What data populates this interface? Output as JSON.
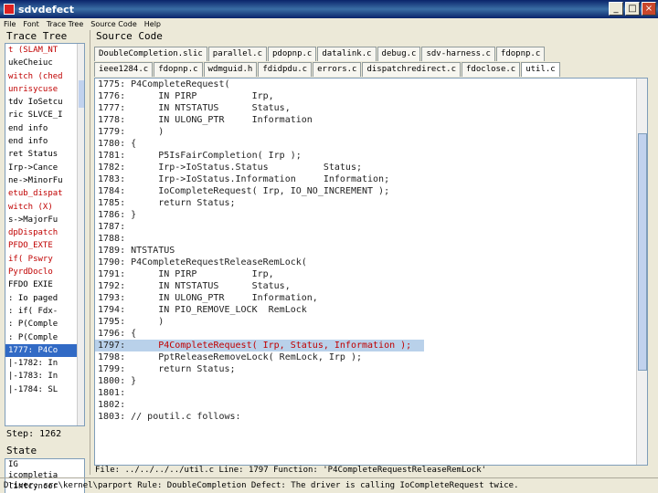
{
  "window": {
    "title": "sdvdefect",
    "minimize": "_",
    "maximize": "□",
    "close": "×"
  },
  "menu": [
    "File",
    "Font",
    "Trace Tree",
    "Source Code",
    "Help"
  ],
  "trace_tree": {
    "header": "Trace Tree",
    "lines": [
      "t (SLAM_NT",
      "ukeCheiuc",
      "witch (ched",
      "unrisycuse",
      "tdv IoSetcu",
      "ric SLVCE_I",
      "end info",
      "end info",
      "ret Status",
      "Irp->Cance",
      "ne->MinorFu",
      "etub_dispat",
      "witch (X)",
      "s->MajorFu",
      "dpDispatch",
      "  PFDO_EXTE",
      "  if( Pswry",
      "  PyrdDoclo",
      "  FFDO EXIE",
      ": Io paged",
      ": if( Fdx-",
      ": P(Comple",
      ": P(Comple",
      "1777: P4Co",
      "|-1782: In",
      "|-1783: In",
      "|-1784: SL"
    ],
    "step_label": "Step: 1262",
    "state_header": "State",
    "state_lines": [
      "IG",
      "icompletia",
      "lintcyncor"
    ]
  },
  "source_code": {
    "header": "Source Code",
    "tabs_row1": [
      "DoubleCompletion.slic",
      "parallel.c",
      "pdopnp.c",
      "datalink.c",
      "debug.c",
      "sdv-harness.c",
      "fdopnp.c"
    ],
    "tabs_row2": [
      "ieee1284.c",
      "fdopnp.c",
      "wdmguid.h",
      "fdidpdu.c",
      "errors.c",
      "dispatchredirect.c",
      "fdoclose.c",
      "util.c"
    ],
    "active_tab_row": 2,
    "active_tab_index": 7,
    "lines": [
      {
        "text": "1775: P4CompleteRequest(",
        "red": ""
      },
      {
        "text": "1776:      IN PIRP          Irp,",
        "red": ""
      },
      {
        "text": "1777:      IN NTSTATUS      Status,",
        "red": ""
      },
      {
        "text": "1778:      IN ULONG_PTR     Information",
        "red": ""
      },
      {
        "text": "1779:      )",
        "red": ""
      },
      {
        "text": "1780: {",
        "red": ""
      },
      {
        "text": "1781:      P5IsFairCompletion( Irp );",
        "red": ""
      },
      {
        "text": "1782:      Irp->IoStatus.Status          Status;",
        "red": ""
      },
      {
        "text": "1783:      Irp->IoStatus.Information     Information;",
        "red": ""
      },
      {
        "text": "1784:      IoCompleteRequest( Irp, IO_NO_INCREMENT );",
        "red": ""
      },
      {
        "text": "1785:      return Status;",
        "red": ""
      },
      {
        "text": "1786: }",
        "red": ""
      },
      {
        "text": "1787:",
        "red": ""
      },
      {
        "text": "1788: ",
        "red": ""
      },
      {
        "text": "1789: NTSTATUS",
        "red": ""
      },
      {
        "text": "1790: P4CompleteRequestReleaseRemLock(",
        "red": ""
      },
      {
        "text": "1791:      IN PIRP          Irp,",
        "red": ""
      },
      {
        "text": "1792:      IN NTSTATUS      Status,",
        "red": ""
      },
      {
        "text": "1793:      IN ULONG_PTR     Information,",
        "red": ""
      },
      {
        "text": "1794:      IN PIO_REMOVE_LOCK  RemLock",
        "red": ""
      },
      {
        "text": "1795:      )",
        "red": ""
      },
      {
        "text": "1796: {",
        "red": ""
      },
      {
        "text": "1797:      ",
        "red": "P4CompleteRequest( Irp, Status, Information );",
        "hl": true
      },
      {
        "text": "1798:      PptReleaseRemoveLock( RemLock, Irp );",
        "red": ""
      },
      {
        "text": "1799:      return Status;",
        "red": ""
      },
      {
        "text": "1800: }",
        "red": ""
      },
      {
        "text": "1801:",
        "red": ""
      },
      {
        "text": "1802:",
        "red": ""
      },
      {
        "text": "1803: // poutil.c follows:",
        "red": ""
      }
    ]
  },
  "file_status": "File:  ../../../../util.c      Line: 1797      Function: 'P4CompleteRequestReleaseRemLock'",
  "bottom_status": "Driver: src\\kernel\\parport    Rule: DoubleCompletion    Defect: The driver is calling IoCompleteRequest twice."
}
